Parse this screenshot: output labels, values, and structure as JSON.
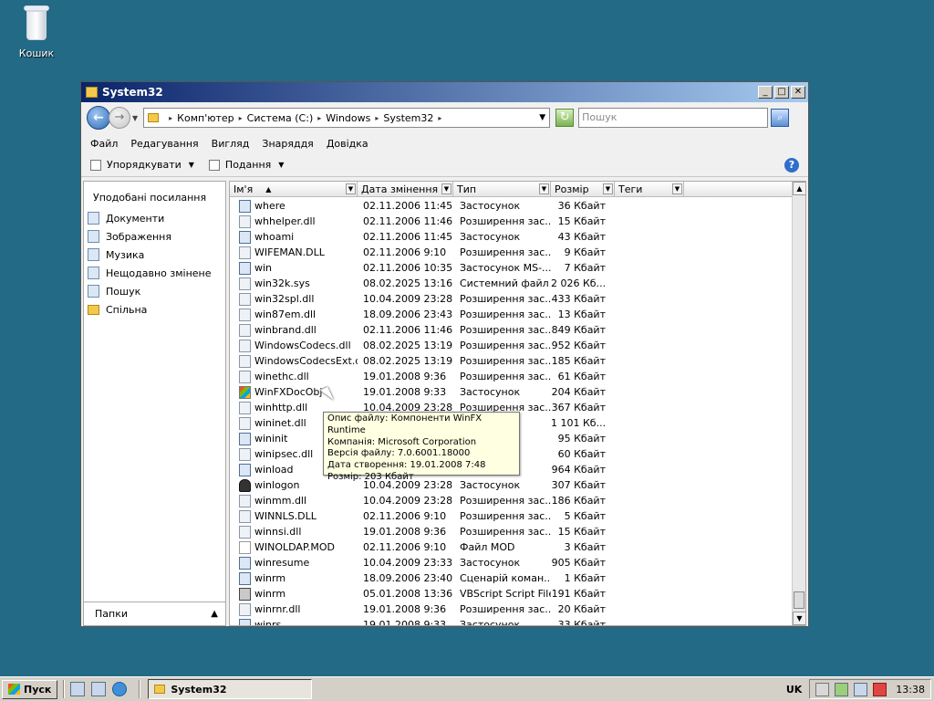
{
  "desktop": {
    "recycle_bin_label": "Кошик"
  },
  "window": {
    "title": "System32",
    "minimize": "_",
    "maximize": "□",
    "close": "✕"
  },
  "address": {
    "crumbs": [
      "Комп'ютер",
      "Система (C:)",
      "Windows",
      "System32"
    ],
    "search_placeholder": "Пошук"
  },
  "menu": [
    "Файл",
    "Редагування",
    "Вигляд",
    "Знаряддя",
    "Довідка"
  ],
  "toolbar": {
    "organize": "Упорядкувати",
    "views": "Подання",
    "help": "?"
  },
  "navpane": {
    "header": "Уподобані посилання",
    "items": [
      "Документи",
      "Зображення",
      "Музика",
      "Нещодавно змінене",
      "Пошук",
      "Спільна"
    ],
    "folders_label": "Папки"
  },
  "columns": {
    "name": "Ім'я",
    "date": "Дата змінення",
    "type": "Тип",
    "size": "Розмір",
    "tags": "Теги"
  },
  "files": [
    {
      "name": "where",
      "date": "02.11.2006 11:45",
      "type": "Застосунок",
      "size": "36 Кбайт",
      "icon": "exe"
    },
    {
      "name": "whhelper.dll",
      "date": "02.11.2006 11:46",
      "type": "Розширення зас...",
      "size": "15 Кбайт",
      "icon": "dll"
    },
    {
      "name": "whoami",
      "date": "02.11.2006 11:45",
      "type": "Застосунок",
      "size": "43 Кбайт",
      "icon": "exe"
    },
    {
      "name": "WIFEMAN.DLL",
      "date": "02.11.2006 9:10",
      "type": "Розширення зас...",
      "size": "9 Кбайт",
      "icon": "dll"
    },
    {
      "name": "win",
      "date": "02.11.2006 10:35",
      "type": "Застосунок MS-...",
      "size": "7 Кбайт",
      "icon": "exe"
    },
    {
      "name": "win32k.sys",
      "date": "08.02.2025 13:16",
      "type": "Системний файл",
      "size": "2 026 Кб...",
      "icon": "dll"
    },
    {
      "name": "win32spl.dll",
      "date": "10.04.2009 23:28",
      "type": "Розширення зас...",
      "size": "433 Кбайт",
      "icon": "dll"
    },
    {
      "name": "win87em.dll",
      "date": "18.09.2006 23:43",
      "type": "Розширення зас...",
      "size": "13 Кбайт",
      "icon": "dll"
    },
    {
      "name": "winbrand.dll",
      "date": "02.11.2006 11:46",
      "type": "Розширення зас...",
      "size": "849 Кбайт",
      "icon": "dll"
    },
    {
      "name": "WindowsCodecs.dll",
      "date": "08.02.2025 13:19",
      "type": "Розширення зас...",
      "size": "952 Кбайт",
      "icon": "dll"
    },
    {
      "name": "WindowsCodecsExt.dll",
      "date": "08.02.2025 13:19",
      "type": "Розширення зас...",
      "size": "185 Кбайт",
      "icon": "dll"
    },
    {
      "name": "winethc.dll",
      "date": "19.01.2008 9:36",
      "type": "Розширення зас...",
      "size": "61 Кбайт",
      "icon": "dll"
    },
    {
      "name": "WinFXDocObj",
      "date": "19.01.2008 9:33",
      "type": "Застосунок",
      "size": "204 Кбайт",
      "icon": "win"
    },
    {
      "name": "winhttp.dll",
      "date": "10.04.2009 23:28",
      "type": "Розширення зас...",
      "size": "367 Кбайт",
      "icon": "dll"
    },
    {
      "name": "wininet.dll",
      "date": "",
      "type": "",
      "size": "1 101 Кб...",
      "icon": "dll"
    },
    {
      "name": "wininit",
      "date": "",
      "type": "",
      "size": "95 Кбайт",
      "icon": "exe"
    },
    {
      "name": "winipsec.dll",
      "date": "",
      "type": "",
      "size": "60 Кбайт",
      "icon": "dll"
    },
    {
      "name": "winload",
      "date": "",
      "type": "",
      "size": "964 Кбайт",
      "icon": "exe"
    },
    {
      "name": "winlogon",
      "date": "10.04.2009 23:28",
      "type": "Застосунок",
      "size": "307 Кбайт",
      "icon": "logon"
    },
    {
      "name": "winmm.dll",
      "date": "10.04.2009 23:28",
      "type": "Розширення зас...",
      "size": "186 Кбайт",
      "icon": "dll"
    },
    {
      "name": "WINNLS.DLL",
      "date": "02.11.2006 9:10",
      "type": "Розширення зас...",
      "size": "5 Кбайт",
      "icon": "dll"
    },
    {
      "name": "winnsi.dll",
      "date": "19.01.2008 9:36",
      "type": "Розширення зас...",
      "size": "15 Кбайт",
      "icon": "dll"
    },
    {
      "name": "WINOLDAP.MOD",
      "date": "02.11.2006 9:10",
      "type": "Файл MOD",
      "size": "3 Кбайт",
      "icon": "blank"
    },
    {
      "name": "winresume",
      "date": "10.04.2009 23:33",
      "type": "Застосунок",
      "size": "905 Кбайт",
      "icon": "exe"
    },
    {
      "name": "winrm",
      "date": "18.09.2006 23:40",
      "type": "Сценарій коман...",
      "size": "1 Кбайт",
      "icon": "exe"
    },
    {
      "name": "winrm",
      "date": "05.01.2008 13:36",
      "type": "VBScript Script File",
      "size": "191 Кбайт",
      "icon": "vbs"
    },
    {
      "name": "winrnr.dll",
      "date": "19.01.2008 9:36",
      "type": "Розширення зас...",
      "size": "20 Кбайт",
      "icon": "dll"
    },
    {
      "name": "winrs",
      "date": "19.01.2008 9:33",
      "type": "Застосунок",
      "size": "33 Кбайт",
      "icon": "exe"
    }
  ],
  "tooltip": [
    "Опис файлу: Компоненти WinFX Runtime",
    "Компанія: Microsoft Corporation",
    "Версія файлу: 7.0.6001.18000",
    "Дата створення: 19.01.2008 7:48",
    "Розмір: 203 Кбайт"
  ],
  "taskbar": {
    "start": "Пуск",
    "task": "System32",
    "lang": "UK",
    "time": "13:38"
  }
}
